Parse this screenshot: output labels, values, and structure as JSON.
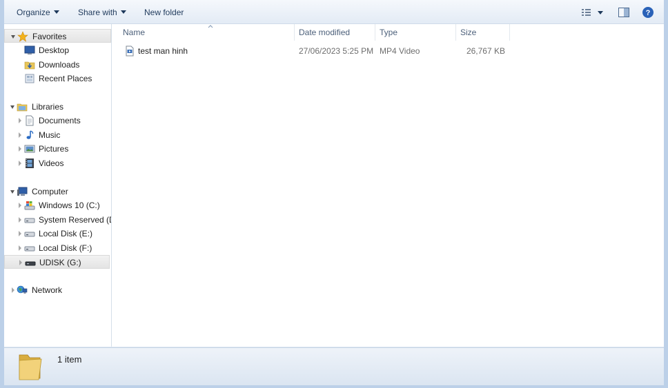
{
  "toolbar": {
    "organize": "Organize",
    "share_with": "Share with",
    "new_folder": "New folder"
  },
  "nav": {
    "favorites": {
      "label": "Favorites",
      "items": [
        "Desktop",
        "Downloads",
        "Recent Places"
      ]
    },
    "libraries": {
      "label": "Libraries",
      "items": [
        "Documents",
        "Music",
        "Pictures",
        "Videos"
      ]
    },
    "computer": {
      "label": "Computer",
      "items": [
        "Windows 10 (C:)",
        "System Reserved (D:",
        "Local Disk (E:)",
        "Local Disk (F:)",
        "UDISK (G:)"
      ]
    },
    "network": {
      "label": "Network"
    }
  },
  "columns": [
    "Name",
    "Date modified",
    "Type",
    "Size"
  ],
  "files": [
    {
      "name": "test man hinh",
      "date": "27/06/2023 5:25 PM",
      "type": "MP4 Video",
      "size": "26,767 KB"
    }
  ],
  "status": {
    "count": "1 item"
  },
  "colors": {
    "accent": "#1e395b",
    "folder": "#e8c65a",
    "selected_bg": "#e4e4e4"
  }
}
